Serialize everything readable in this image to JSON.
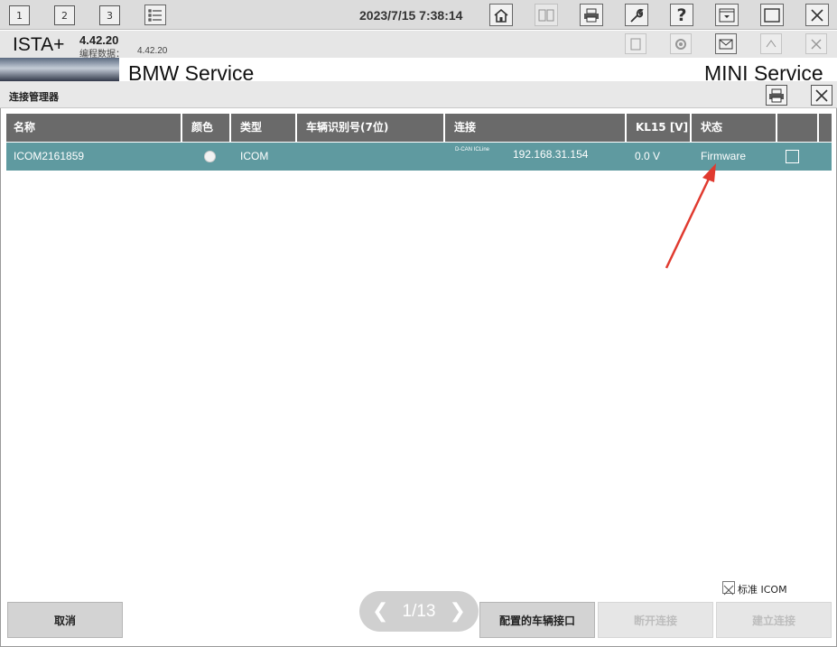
{
  "toolbar": {
    "tabs": [
      "1",
      "2",
      "3"
    ],
    "datetime": "2023/7/15 7:38:14",
    "help_label": "?"
  },
  "header": {
    "app_name": "ISTA+",
    "version": "4.42.20",
    "programming_label": "编程数据：",
    "programming_version": "4.42.20"
  },
  "banner": {
    "left_brand": "BMW Service",
    "right_brand": "MINI Service"
  },
  "dialog": {
    "title": "连接管理器",
    "columns": [
      "名称",
      "颜色",
      "类型",
      "车辆识别号(7位)",
      "连接",
      "KL15 [V]",
      "状态",
      ""
    ],
    "rows": [
      {
        "name": "ICOM2161859",
        "color": "white",
        "type": "ICOM",
        "vin": "",
        "connection_tag": "D-CAN ICLine",
        "connection_ip": "192.168.31.154",
        "kl15": "0.0 V",
        "status": "Firmware",
        "checked": false
      }
    ],
    "standard_icom_label": "标准 ICOM",
    "standard_icom_checked": true,
    "pager": "1/13",
    "buttons": {
      "cancel": "取消",
      "configure": "配置的车辆接口",
      "disconnect": "断开连接",
      "connect": "建立连接"
    }
  },
  "colors": {
    "row_selected": "#5f9aa0",
    "header_bg": "#6a6a6a",
    "annotation_arrow": "#e03a2f"
  }
}
